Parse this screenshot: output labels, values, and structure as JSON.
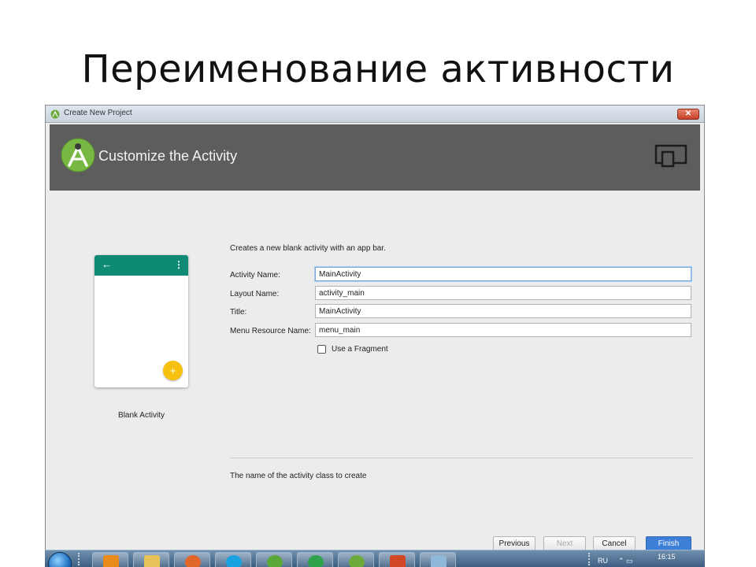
{
  "slide": {
    "title": "Переименование активности"
  },
  "window": {
    "title": "Create New Project",
    "close_label": "✕"
  },
  "header": {
    "title": "Customize the Activity"
  },
  "preview": {
    "caption": "Blank Activity",
    "back_glyph": "←",
    "menu_glyph": "⋮",
    "fab_glyph": "+"
  },
  "form": {
    "intro": "Creates a new blank activity with an app bar.",
    "fields": [
      {
        "label": "Activity Name:",
        "value": "MainActivity"
      },
      {
        "label": "Layout Name:",
        "value": "activity_main"
      },
      {
        "label": "Title:",
        "value": "MainActivity"
      },
      {
        "label": "Menu Resource Name:",
        "value": "menu_main"
      }
    ],
    "checkbox_label": "Use a Fragment",
    "help_text": "The name of the activity class to create"
  },
  "buttons": {
    "previous": "Previous",
    "next": "Next",
    "cancel": "Cancel",
    "finish": "Finish"
  },
  "taskbar": {
    "lang": "RU",
    "clock": "16:15"
  },
  "colors": {
    "header": "#5d5d5d",
    "app_bar": "#0f8a74",
    "fab": "#f7c20f",
    "primary_button": "#3d7fd6"
  }
}
